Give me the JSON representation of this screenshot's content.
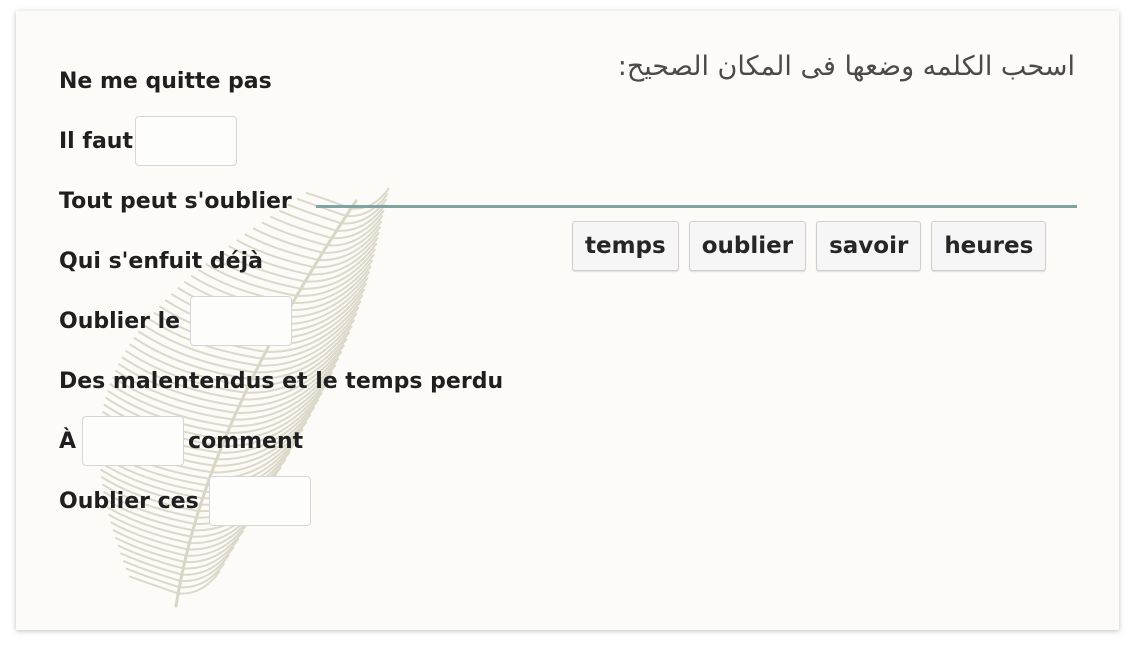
{
  "instruction": "اسحب الكلمه وضعها فى المكان الصحيح:",
  "lines": [
    {
      "before": "Ne me quitte pas",
      "after": ""
    },
    {
      "before": "Il faut",
      "after": ""
    },
    {
      "before": "Tout peut s'oublier",
      "after": ""
    },
    {
      "before": "Qui s'enfuit déjà",
      "after": ""
    },
    {
      "before": "Oublier le",
      "after": ""
    },
    {
      "before": "Des malentendus et le temps perdu",
      "after": ""
    },
    {
      "before": "À",
      "after": "comment"
    },
    {
      "before": "Oublier ces",
      "after": ""
    }
  ],
  "word_bank": [
    "temps",
    "oublier",
    "savoir",
    "heures"
  ],
  "colors": {
    "background": "#fcfbf7",
    "divider": "#7fa3a0",
    "chip_background": "#f6f6f6",
    "feather": "#d9d6c6"
  },
  "icons": {
    "background_decoration": "feather-icon"
  }
}
